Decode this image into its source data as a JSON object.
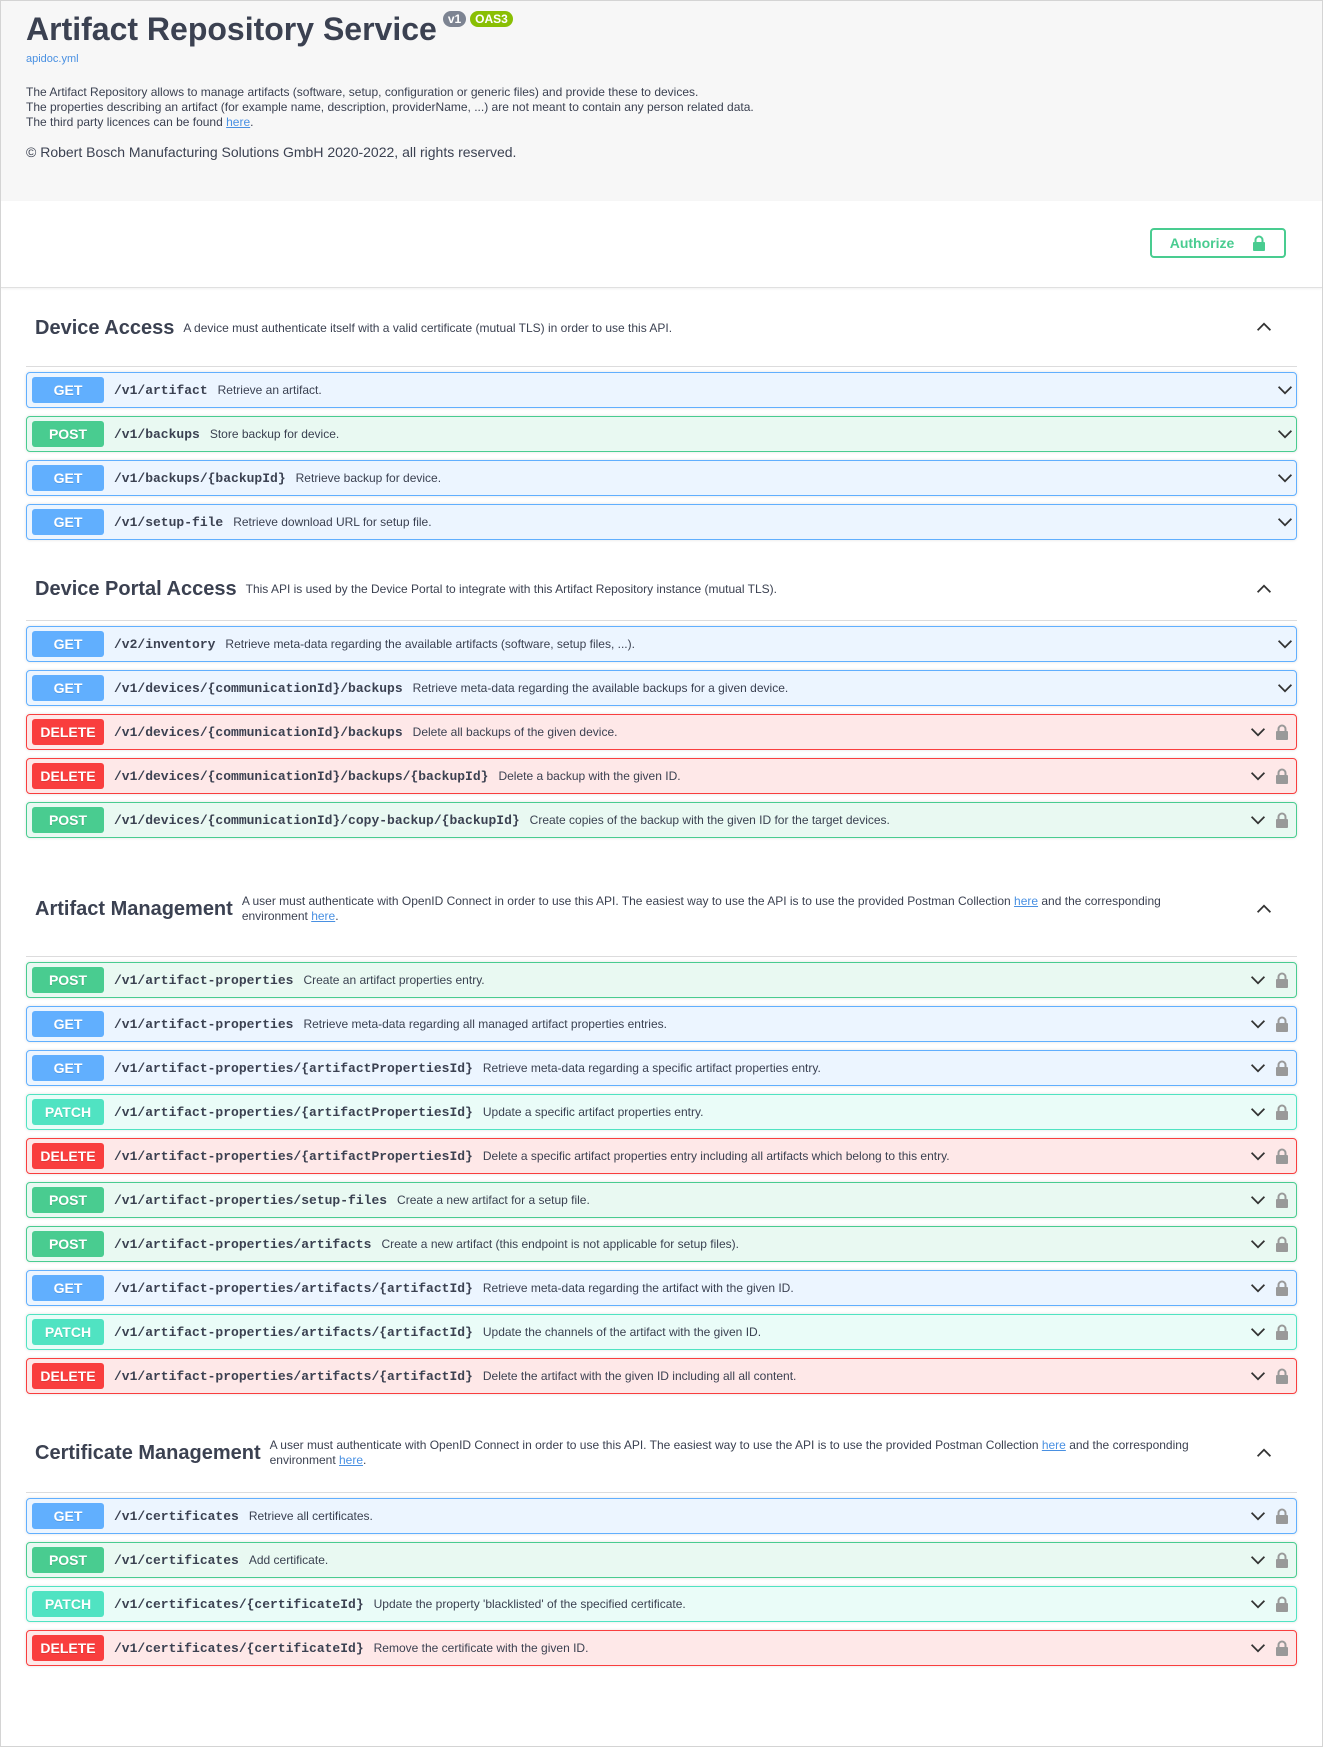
{
  "info": {
    "title": "Artifact Repository Service",
    "version_badge": "v1",
    "oas_badge": "OAS3",
    "spec_link": "apidoc.yml",
    "description_lines": [
      "The Artifact Repository allows to manage artifacts (software, setup, configuration or generic files) and provide these to devices.",
      "The properties describing an artifact (for example name, description, providerName, ...) are not meant to contain any person related data."
    ],
    "licences_prefix": "The third party licences can be found ",
    "licences_link": "here",
    "licences_suffix": ".",
    "copyright": "© Robert Bosch Manufacturing Solutions GmbH 2020-2022, all rights reserved."
  },
  "authorize": {
    "label": "Authorize",
    "icon": "lock-icon",
    "color": "#49cc90"
  },
  "colors": {
    "get": "#61affe",
    "post": "#49cc90",
    "delete": "#f93e3e",
    "patch": "#50e3c2"
  },
  "sections": [
    {
      "name": "Device Access",
      "description": "A device must authenticate itself with a valid certificate (mutual TLS) in order to use this API.",
      "ops": [
        {
          "method": "GET",
          "path": "/v1/artifact",
          "summary": "Retrieve an artifact.",
          "locked": false
        },
        {
          "method": "POST",
          "path": "/v1/backups",
          "summary": "Store backup for device.",
          "locked": false
        },
        {
          "method": "GET",
          "path": "/v1/backups/{backupId}",
          "summary": "Retrieve backup for device.",
          "locked": false
        },
        {
          "method": "GET",
          "path": "/v1/setup-file",
          "summary": "Retrieve download URL for setup file.",
          "locked": false
        }
      ]
    },
    {
      "name": "Device Portal Access",
      "description": "This API is used by the Device Portal to integrate with this Artifact Repository instance (mutual TLS).",
      "ops": [
        {
          "method": "GET",
          "path": "/v2/inventory",
          "summary": "Retrieve meta-data regarding the available artifacts (software, setup files, ...).",
          "locked": false
        },
        {
          "method": "GET",
          "path": "/v1/devices/{communicationId}/backups",
          "summary": "Retrieve meta-data regarding the available backups for a given device.",
          "locked": false
        },
        {
          "method": "DELETE",
          "path": "/v1/devices/{communicationId}/backups",
          "summary": "Delete all backups of the given device.",
          "locked": true
        },
        {
          "method": "DELETE",
          "path": "/v1/devices/{communicationId}/backups/{backupId}",
          "summary": "Delete a backup with the given ID.",
          "locked": true
        },
        {
          "method": "POST",
          "path": "/v1/devices/{communicationId}/copy-backup/{backupId}",
          "summary": "Create copies of the backup with the given ID for the target devices.",
          "locked": true
        }
      ]
    },
    {
      "name": "Artifact Management",
      "description_prefix": "A user must authenticate with OpenID Connect in order to use this API. The easiest way to use the API is to use the provided Postman Collection ",
      "description_link1": "here",
      "description_mid": " and the corresponding environment ",
      "description_link2": "here",
      "description_suffix": ".",
      "ops": [
        {
          "method": "POST",
          "path": "/v1/artifact-properties",
          "summary": "Create an artifact properties entry.",
          "locked": true
        },
        {
          "method": "GET",
          "path": "/v1/artifact-properties",
          "summary": "Retrieve meta-data regarding all managed artifact properties entries.",
          "locked": true
        },
        {
          "method": "GET",
          "path": "/v1/artifact-properties/{artifactPropertiesId}",
          "summary": "Retrieve meta-data regarding a specific artifact properties entry.",
          "locked": true
        },
        {
          "method": "PATCH",
          "path": "/v1/artifact-properties/{artifactPropertiesId}",
          "summary": "Update a specific artifact properties entry.",
          "locked": true
        },
        {
          "method": "DELETE",
          "path": "/v1/artifact-properties/{artifactPropertiesId}",
          "summary": "Delete a specific artifact properties entry including all artifacts which belong to this entry.",
          "locked": true
        },
        {
          "method": "POST",
          "path": "/v1/artifact-properties/setup-files",
          "summary": "Create a new artifact for a setup file.",
          "locked": true
        },
        {
          "method": "POST",
          "path": "/v1/artifact-properties/artifacts",
          "summary": "Create a new artifact (this endpoint is not applicable for setup files).",
          "locked": true
        },
        {
          "method": "GET",
          "path": "/v1/artifact-properties/artifacts/{artifactId}",
          "summary": "Retrieve meta-data regarding the artifact with the given ID.",
          "locked": true
        },
        {
          "method": "PATCH",
          "path": "/v1/artifact-properties/artifacts/{artifactId}",
          "summary": "Update the channels of the artifact with the given ID.",
          "locked": true
        },
        {
          "method": "DELETE",
          "path": "/v1/artifact-properties/artifacts/{artifactId}",
          "summary": "Delete the artifact with the given ID including all all content.",
          "locked": true
        }
      ]
    },
    {
      "name": "Certificate Management",
      "description_prefix": "A user must authenticate with OpenID Connect in order to use this API. The easiest way to use the API is to use the provided Postman Collection ",
      "description_link1": "here",
      "description_mid": " and the corresponding environment ",
      "description_link2": "here",
      "description_suffix": ".",
      "ops": [
        {
          "method": "GET",
          "path": "/v1/certificates",
          "summary": "Retrieve all certificates.",
          "locked": true
        },
        {
          "method": "POST",
          "path": "/v1/certificates",
          "summary": "Add certificate.",
          "locked": true
        },
        {
          "method": "PATCH",
          "path": "/v1/certificates/{certificateId}",
          "summary": "Update the property 'blacklisted' of the specified certificate.",
          "locked": true
        },
        {
          "method": "DELETE",
          "path": "/v1/certificates/{certificateId}",
          "summary": "Remove the certificate with the given ID.",
          "locked": true
        }
      ]
    }
  ]
}
